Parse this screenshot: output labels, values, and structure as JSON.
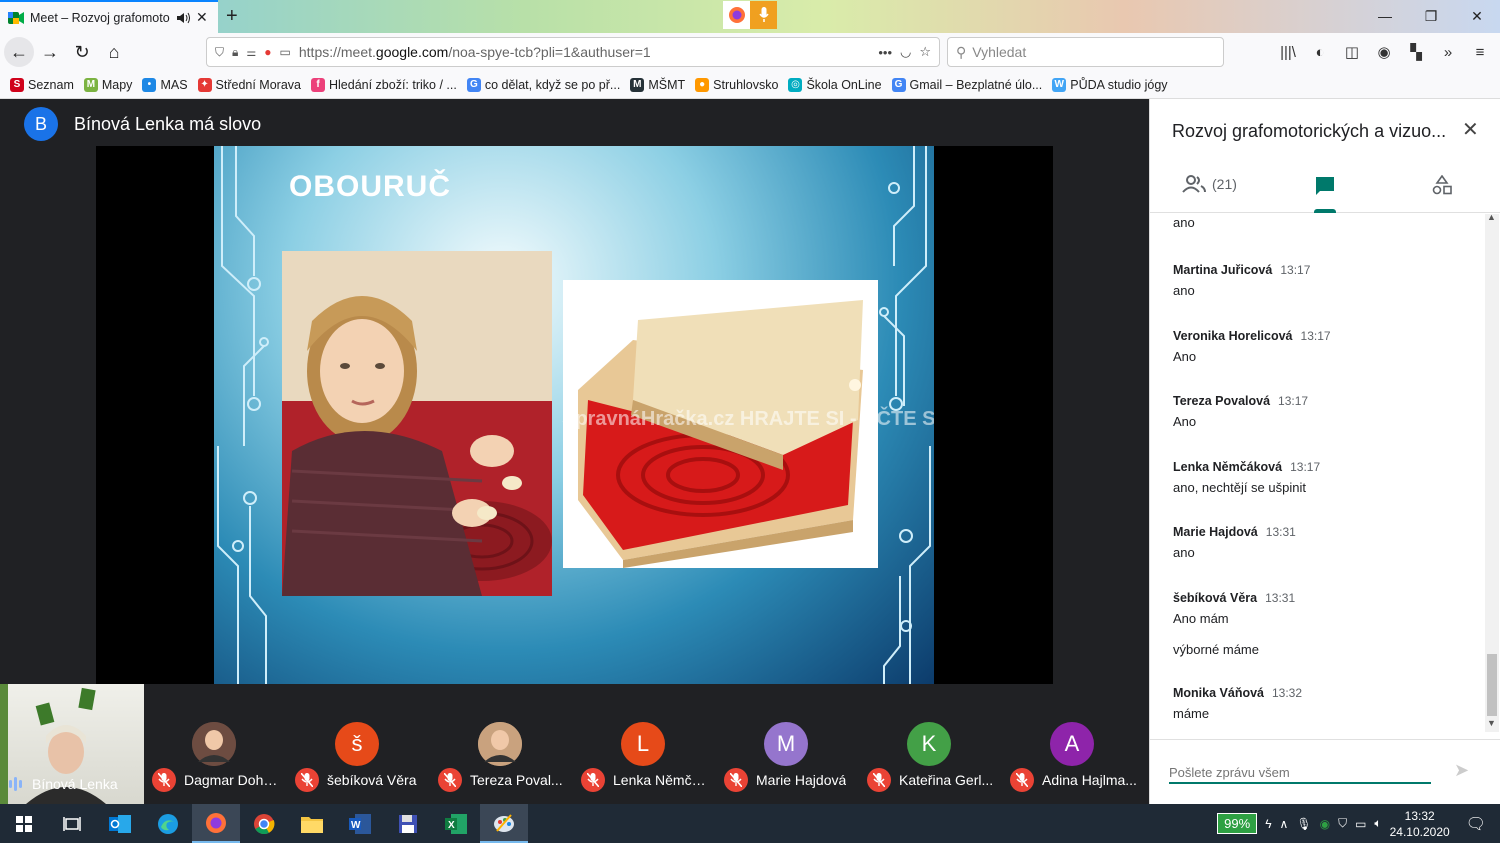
{
  "browser": {
    "tab_title": "Meet – Rozvoj grafomotoric",
    "new_tab": "+",
    "url_prefix": "https://meet.",
    "url_domain": "google.com",
    "url_path": "/noa-spye-tcb?pli=1&authuser=1",
    "search_placeholder": "Vyhledat",
    "bookmarks": [
      {
        "label": "Seznam",
        "color": "#d0021b",
        "glyph": "S"
      },
      {
        "label": "Mapy",
        "color": "#7cb342",
        "glyph": "M"
      },
      {
        "label": "MAS",
        "color": "#1e88e5",
        "glyph": "•"
      },
      {
        "label": "Střední Morava",
        "color": "#e53935",
        "glyph": "✦"
      },
      {
        "label": "Hledání zboží: triko / ...",
        "color": "#ec407a",
        "glyph": "f"
      },
      {
        "label": "co dělat, když se po př...",
        "color": "#4285f4",
        "glyph": "G"
      },
      {
        "label": "MŠMT",
        "color": "#263238",
        "glyph": "M"
      },
      {
        "label": "Struhlovsko",
        "color": "#ff9800",
        "glyph": "●"
      },
      {
        "label": "Škola OnLine",
        "color": "#00acc1",
        "glyph": "◎"
      },
      {
        "label": "Gmail – Bezplatné úlo...",
        "color": "#4285f4",
        "glyph": "G"
      },
      {
        "label": "PŮDA studio jógy",
        "color": "#42a5f5",
        "glyph": "W"
      }
    ]
  },
  "meet": {
    "speaker_initial": "B",
    "speaker_text": "Bínová Lenka má slovo",
    "slide_title": "OBOURUČ",
    "slide_watermark": "SpravnáHračka.cz  HRAJTE SI - UČTE SI",
    "self_name": "Bínová Lenka",
    "participants": [
      {
        "initial": "",
        "name": "Dagmar Dohn...",
        "color": "#6d4c41",
        "photo": true
      },
      {
        "initial": "š",
        "name": "šebíková Věra",
        "color": "#e64a19",
        "photo": false
      },
      {
        "initial": "",
        "name": "Tereza Poval...",
        "color": "#c9a27e",
        "photo": true
      },
      {
        "initial": "L",
        "name": "Lenka Němčá...",
        "color": "#e64a19",
        "photo": false
      },
      {
        "initial": "M",
        "name": "Marie Hajdová",
        "color": "#9575cd",
        "photo": false
      },
      {
        "initial": "K",
        "name": "Kateřina Gerl...",
        "color": "#43a047",
        "photo": false
      },
      {
        "initial": "A",
        "name": "Adina Hajlma...",
        "color": "#8e24aa",
        "photo": false
      }
    ]
  },
  "panel": {
    "title": "Rozvoj grafomotorických a vizuo...",
    "people_count": "(21)",
    "messages": [
      {
        "sender": "",
        "time": "",
        "lines": [
          "ano"
        ]
      },
      {
        "sender": "Martina Juřicová",
        "time": "13:17",
        "lines": [
          "ano"
        ]
      },
      {
        "sender": "Veronika Horelicová",
        "time": "13:17",
        "lines": [
          "Ano"
        ]
      },
      {
        "sender": "Tereza Povalová",
        "time": "13:17",
        "lines": [
          "Ano"
        ]
      },
      {
        "sender": "Lenka Němčáková",
        "time": "13:17",
        "lines": [
          "ano, nechtějí se ušpinit"
        ]
      },
      {
        "sender": "Marie Hajdová",
        "time": "13:31",
        "lines": [
          "ano"
        ]
      },
      {
        "sender": "šebíková Věra",
        "time": "13:31",
        "lines": [
          "Ano  mám",
          "výborné máme"
        ]
      },
      {
        "sender": "Monika Váňová",
        "time": "13:32",
        "lines": [
          "máme"
        ]
      }
    ],
    "input_placeholder": "Pošlete zprávu všem"
  },
  "taskbar": {
    "battery": "99%",
    "time": "13:32",
    "date": "24.10.2020"
  }
}
